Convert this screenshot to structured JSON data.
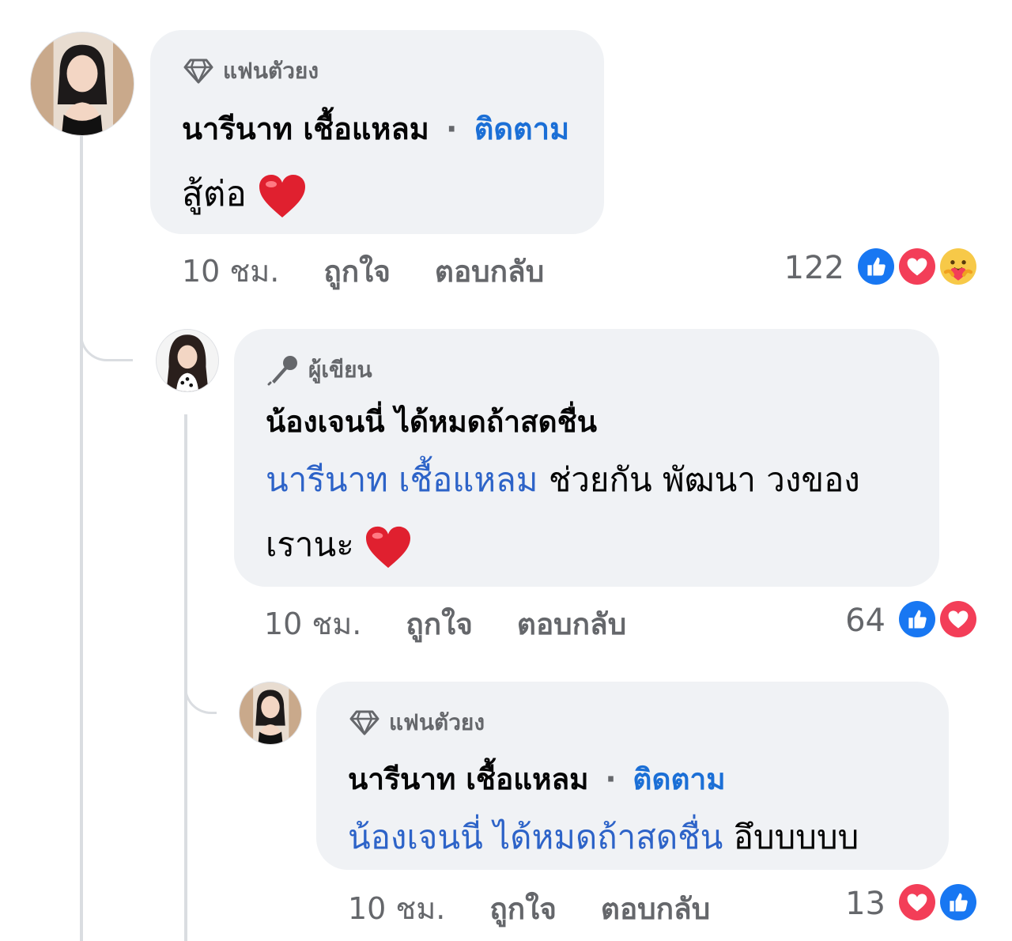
{
  "comments": [
    {
      "badge": "แฟนตัวยง",
      "author": "นารีนาท เชื้อแหลม",
      "separator": "·",
      "follow": "ติดตาม",
      "text": "สู้ต่อ",
      "time": "10 ชม.",
      "like": "ถูกใจ",
      "reply": "ตอบกลับ",
      "reaction_count": "122",
      "reactions": [
        "like-icon",
        "love-icon",
        "care-icon"
      ]
    },
    {
      "badge": "ผู้เขียน",
      "author": "น้องเจนนี่ ได้หมดถ้าสดชื่น",
      "mention": "นารีนาท เชื้อแหลม",
      "text_line1": "ช่วยกัน พัฒนา วงของ",
      "text_line2": "เรานะ",
      "time": "10 ชม.",
      "like": "ถูกใจ",
      "reply": "ตอบกลับ",
      "reaction_count": "64",
      "reactions": [
        "like-icon",
        "love-icon"
      ]
    },
    {
      "badge": "แฟนตัวยง",
      "author": "นารีนาท เชื้อแหลม",
      "separator": "·",
      "follow": "ติดตาม",
      "mention": "น้องเจนนี่ ได้หมดถ้าสดชื่น",
      "text": "อึบบบบบ",
      "time": "10 ชม.",
      "like": "ถูกใจ",
      "reply": "ตอบกลับ",
      "reaction_count": "13",
      "reactions": [
        "love-icon",
        "like-icon"
      ]
    }
  ],
  "colors": {
    "bubble": "#f0f2f5",
    "thread_line": "#dadde1",
    "link": "#1b6fd6",
    "meta": "#65676b",
    "like_blue": "#1877f2",
    "love_red": "#f33e58"
  }
}
